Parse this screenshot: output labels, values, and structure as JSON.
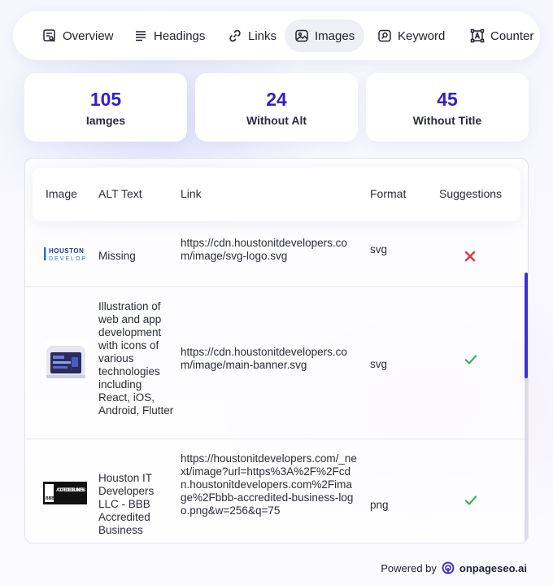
{
  "tabs": [
    {
      "label": "Overview",
      "icon": "overview-icon"
    },
    {
      "label": "Headings",
      "icon": "headings-icon"
    },
    {
      "label": "Links",
      "icon": "link-icon"
    },
    {
      "label": "Images",
      "icon": "image-icon",
      "active": true
    },
    {
      "label": "Keyword",
      "icon": "keyword-icon"
    },
    {
      "label": "Counter",
      "icon": "counter-icon"
    }
  ],
  "stats": [
    {
      "value": "105",
      "label": "Iamges"
    },
    {
      "value": "24",
      "label": "Without Alt"
    },
    {
      "value": "45",
      "label": "Without Title"
    }
  ],
  "table": {
    "headers": [
      "Image",
      "ALT Text",
      "Link",
      "Format",
      "Suggestions"
    ],
    "rows": [
      {
        "thumb_text": "HOUSTON IT DEVELOPERS",
        "alt": "Missing",
        "link": "https://cdn.houstonitdevelopers.com/image/svg-logo.svg",
        "format": "svg",
        "suggestion": "cross"
      },
      {
        "alt": "Illustration of web and app development with icons of various technologies including React, iOS, Android, Flutter",
        "link": "https://cdn.houstonitdevelopers.com/image/main-banner.svg",
        "format": "svg",
        "suggestion": "check"
      },
      {
        "thumb_text": "ACCREDITED BUSINESS",
        "thumb_badge": "BBB",
        "alt": "Houston IT Developers LLC - BBB Accredited Business",
        "link": "https://houstonitdevelopers.com/_next/image?url=https%3A%2F%2Fcdn.houstonitdevelopers.com%2Fimage%2Fbbb-accredited-business-logo.png&w=256&q=75",
        "format": "png",
        "suggestion": "check"
      }
    ]
  },
  "footer": {
    "powered": "Powered by",
    "brand": "onpageseo.ai"
  },
  "colors": {
    "accent": "#3022c9",
    "cross": "#e0393e",
    "check": "#3fae54"
  }
}
